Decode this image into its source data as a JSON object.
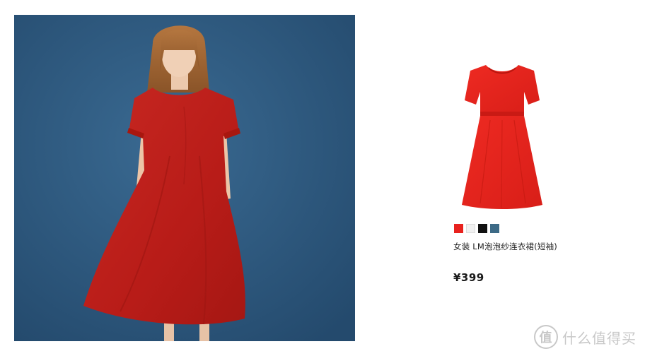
{
  "product": {
    "name": "女装 LM泡泡纱连衣裙(短袖)",
    "price": "¥399",
    "swatches": [
      {
        "name": "red",
        "color": "#e8221e"
      },
      {
        "name": "off-white",
        "color": "#f1f1f1"
      },
      {
        "name": "black",
        "color": "#111111"
      },
      {
        "name": "slate-blue",
        "color": "#3d6a86"
      }
    ]
  },
  "hero": {
    "background_color": "#2f5a80",
    "dress_color": "#c4201c"
  },
  "watermark": {
    "logo_glyph": "值",
    "text": "什么值得买"
  }
}
